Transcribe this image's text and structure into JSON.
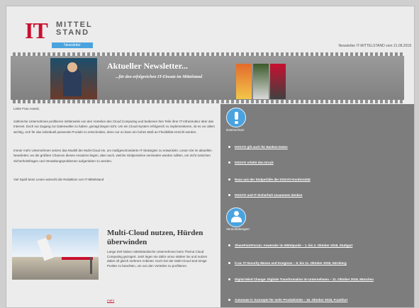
{
  "header": {
    "logo_it": "IT",
    "logo_line1": "MITTEL",
    "logo_line2": "STAND",
    "logo_tag": "Newsletter",
    "newsletter_date": "Newsletter IT-MITTELSTAND vom 21.08.2018"
  },
  "banner": {
    "title": "Aktueller Newsletter...",
    "subtitle": "...für den erfolgreichen IT-Einsatz im Mittelstand"
  },
  "intro": {
    "greeting": "Liebe Frau Anand,",
    "paragraphs": [
      "zahlreiche Unternehmen profitieren mittlerweile von den Vorteilen des Cloud Computing und bedienen Ihre Teile ihrer IT-Infrastruktur über das Internet. Doch nur Zugang zur Datenwolke zu haben, genügt längst nicht. Um ein Cloud-System erfolgreich zu implementieren, ist es vor allem wichtig, sich für das individuell passende Produkt zu entscheiden, denn nur so kann ein hohes Maß an Flexibilität erreicht werden.",
      "Immer mehr Unternehmen setzen das Modell der Multi-Cloud ein, um maßgeschneiderte IT-Strategien zu entwickeln. Lesen Sie im aktuellen Newsletter, wo die größten Chancen dieses Ansatzes liegen, aber auch, welche Stolpersteine vermieden werden sollten, um nicht zwischen Sicherheitsfragen und Verwaltungsproblemen aufgerieben zu werden.",
      "Viel Spaß beim Lesen wünscht die Redaktion von IT-Mittelstand"
    ]
  },
  "article": {
    "title": "Multi-Cloud nutzen, Hürden überwinden",
    "text": "Lange Zeit haben mittelständische Unternehmen beim Thema Cloud Computing gezögert. Jetzt legen sie dafür umso stärker los und nutzen dabei oft gleich mehrere Anbieter. Doch bei der Multi-Cloud sind einige Punkte zu beachten, um von den Vorteilen zu profitieren.",
    "more": "mehr"
  },
  "sidebar": {
    "section1_label": "Datenschutz:",
    "section1_items": [
      "DSGVO gilt auch für Banken-Daten",
      "DSGVO erhöht den Druck",
      "Raus aus der Stolperfalle der DSGVO-Konformität",
      "DSGVO und IT-Sicherheit zusammen denken"
    ],
    "section2_label": "Veranstaltungen:",
    "section2_items": [
      "SharePointForum: Anwender im Mittelpunkt – 1. bis 2. Oktober 2018, Stuttgart",
      "it-sa: IT-Security Messe und Kongress – 9. bis 11. Oktober 2018, Nürnberg",
      "Digital Mind Change: Digitale Transformation im Unternehmen – 11. Oktober 2018, München",
      "Automate it: Konzepte für mehr Produktivität – 16. Oktober 2018, Frankfurt"
    ]
  }
}
